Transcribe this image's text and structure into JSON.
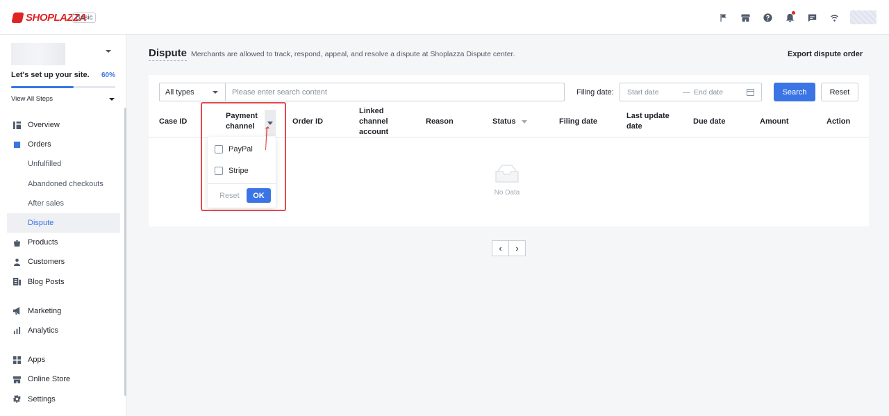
{
  "topbar": {
    "brand": "SHOPLAZZA",
    "plan": "Basic",
    "icons": [
      "flag-icon",
      "store-icon",
      "help-icon",
      "bell-icon",
      "chat-icon",
      "wifi-icon"
    ]
  },
  "sidebar": {
    "setup_title": "Let's set up your site.",
    "setup_percent": "60%",
    "setup_progress": 0.6,
    "view_steps": "View All Steps",
    "items": [
      {
        "label": "Overview",
        "icon": "overview-icon"
      },
      {
        "label": "Orders",
        "icon": "orders-icon"
      },
      {
        "label": "Unfulfilled"
      },
      {
        "label": "Abandoned checkouts"
      },
      {
        "label": "After sales"
      },
      {
        "label": "Dispute"
      },
      {
        "label": "Products",
        "icon": "bag-icon"
      },
      {
        "label": "Customers",
        "icon": "person-icon"
      },
      {
        "label": "Blog Posts",
        "icon": "blog-icon"
      },
      {
        "label": "Marketing",
        "icon": "megaphone-icon"
      },
      {
        "label": "Analytics",
        "icon": "bar-chart-icon"
      },
      {
        "label": "Apps",
        "icon": "apps-icon"
      },
      {
        "label": "Online Store",
        "icon": "store-icon"
      },
      {
        "label": "Settings",
        "icon": "gear-icon"
      }
    ]
  },
  "page": {
    "title": "Dispute",
    "description": "Merchants are allowed to track, respond, appeal, and resolve a dispute at Shoplazza Dispute center.",
    "export_label": "Export dispute order"
  },
  "filters": {
    "type_value": "All types",
    "search_placeholder": "Please enter search content",
    "filing_label": "Filing date:",
    "start_placeholder": "Start date",
    "separator": "—",
    "end_placeholder": "End date",
    "search_label": "Search",
    "reset_label": "Reset"
  },
  "table": {
    "columns": [
      "Case ID",
      "Payment channel",
      "Order ID",
      "Linked channel account",
      "Reason",
      "Status",
      "Filing date",
      "Last update date",
      "Due date",
      "Amount",
      "Action"
    ],
    "empty_text": "No Data"
  },
  "dropdown": {
    "options": [
      "PayPal",
      "Stripe"
    ],
    "reset_label": "Reset",
    "ok_label": "OK"
  },
  "colors": {
    "brand": "#e02424",
    "accent": "#3b74e5",
    "annotation": "#e5484d"
  }
}
